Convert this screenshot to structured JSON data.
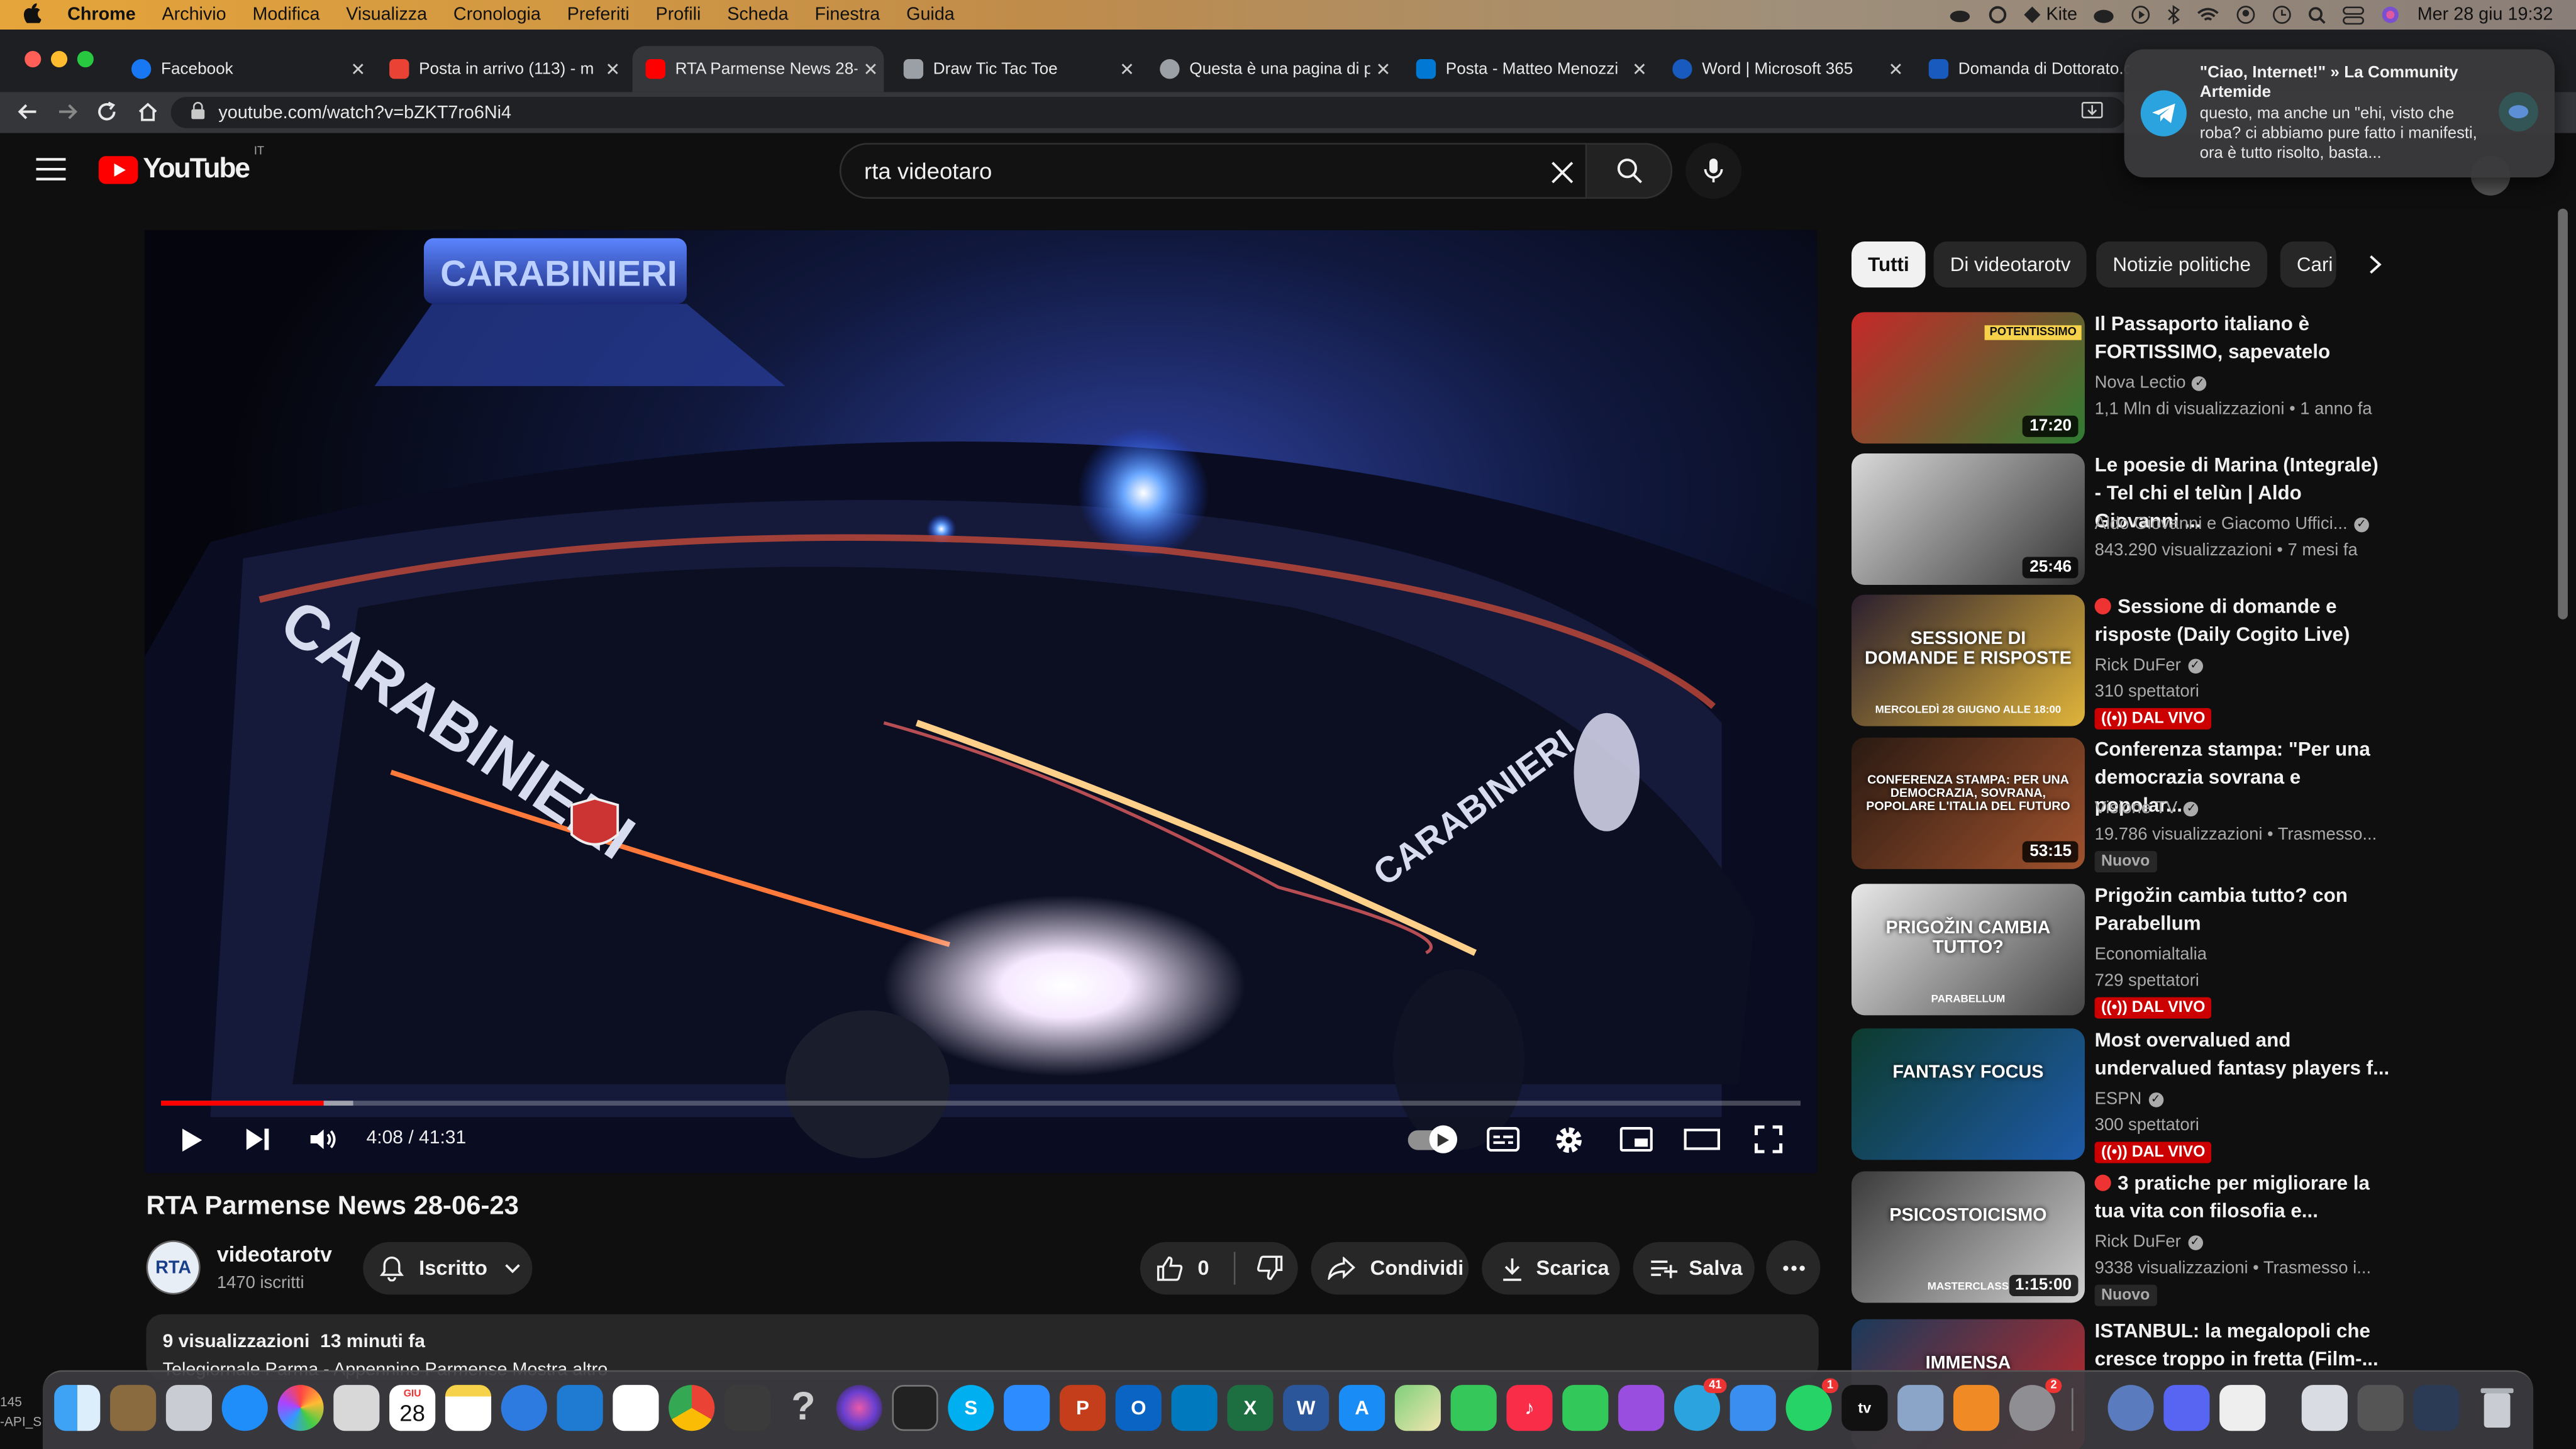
{
  "menubar": {
    "app": "Chrome",
    "items": [
      "Archivio",
      "Modifica",
      "Visualizza",
      "Cronologia",
      "Preferiti",
      "Profili",
      "Scheda",
      "Finestra",
      "Guida"
    ],
    "kite_label": "Kite",
    "clock": "Mer 28 giu  19:32"
  },
  "tabs": [
    {
      "title": "Facebook",
      "favicon_color": "#1877f2"
    },
    {
      "title": "Posta in arrivo (113) - m",
      "favicon_color": "#ea4335"
    },
    {
      "title": "RTA Parmense News 28-",
      "favicon_color": "#ff0000"
    },
    {
      "title": "Draw Tic Tac Toe",
      "favicon_color": "#9aa0a6"
    },
    {
      "title": "Questa è una pagina di p",
      "favicon_color": "#9aa0a6"
    },
    {
      "title": "Posta - Matteo Menozzi",
      "favicon_color": "#0078d4"
    },
    {
      "title": "Word | Microsoft 365",
      "favicon_color": "#185abd"
    },
    {
      "title": "Domanda di Dottorato.c",
      "favicon_color": "#185abd"
    }
  ],
  "address": {
    "url": "youtube.com/watch?v=bZKT7ro6Ni4"
  },
  "notification": {
    "title": "\"Ciao, Internet!\" » La Community Artemide",
    "body": "questo, ma anche un \"ehi, visto che roba? ci abbiamo pure fatto i manifesti, ora è tutto risolto, basta..."
  },
  "youtube": {
    "logo_text": "YouTube",
    "country": "IT",
    "search_value": "rta videotaro"
  },
  "video": {
    "time": "4:08 / 41:31",
    "played_fraction": 0.0996,
    "buffered_fraction": 0.117,
    "overlay_texts": [
      "CARABINIERI",
      "CARABINIERI",
      "CARABINIERI"
    ]
  },
  "info": {
    "title": "RTA Parmense News 28-06-23",
    "channel": "videotarotv",
    "avatar_text": "RTA",
    "subscribers": "1470 iscritti",
    "subscribed_label": "Iscritto",
    "likes": "0",
    "share": "Condividi",
    "download": "Scarica",
    "save": "Salva",
    "views_time": "9 visualizzazioni  13 minuti fa",
    "desc_line": "Telegiornale Parma - Appennino Parmense Mostra altro"
  },
  "chips": [
    "Tutti",
    "Di videotarotv",
    "Notizie politiche",
    "Cari"
  ],
  "recommendations": [
    {
      "title": "Il Passaporto italiano è FORTISSIMO, sapevatelo",
      "channel": "Nova Lectio",
      "verified": true,
      "meta": "1,1 Mln di visualizzazioni  • 1 anno fa",
      "duration": "17:20",
      "thumb_text": "POTENTISSIMO",
      "thumb_colors": [
        "#c62828",
        "#2e7d32"
      ]
    },
    {
      "title": "Le poesie di Marina (Integrale) - Tel chi el telùn | Aldo Giovanni ...",
      "channel": "Aldo Giovanni e Giacomo Uffici...",
      "verified": true,
      "meta": "843.290 visualizzazioni  • 7 mesi fa",
      "duration": "25:46",
      "thumb_text": "",
      "thumb_colors": [
        "#d9d9d9",
        "#333333"
      ]
    },
    {
      "title": "Sessione di domande e risposte (Daily Cogito Live)",
      "channel": "Rick DuFer",
      "verified": true,
      "meta": "310 spettatori",
      "live_badge": "DAL VIVO",
      "thumb_text": "SESSIONE DI DOMANDE E RISPOSTE",
      "thumb_sub": "MERCOLEDÌ 28 GIUGNO ALLE 18:00",
      "thumb_colors": [
        "#2b1f2e",
        "#e0b43a"
      ]
    },
    {
      "title": "Conferenza stampa: \"Per una democrazia sovrana e popolar...",
      "channel": "Visione TV",
      "verified": true,
      "meta": "19.786 visualizzazioni  • Trasmesso...",
      "new_badge": "Nuovo",
      "duration": "53:15",
      "thumb_text": "CONFERENZA STAMPA: PER UNA DEMOCRAZIA, SOVRANA, POPOLARE L'ITALIA DEL FUTURO",
      "thumb_colors": [
        "#2a1a12",
        "#a0522d"
      ]
    },
    {
      "title": "Prigožin cambia tutto? con Parabellum",
      "channel": "Economialtalia",
      "verified": false,
      "meta": "729 spettatori",
      "live_badge": "DAL VIVO",
      "thumb_text": "PRIGOŽIN CAMBIA TUTTO?",
      "thumb_sub": "PARABELLUM",
      "thumb_colors": [
        "#e8e8e8",
        "#444444"
      ]
    },
    {
      "title": "Most overvalued and undervalued fantasy players f...",
      "channel": "ESPN",
      "verified": true,
      "meta": "300 spettatori",
      "live_badge": "DAL VIVO",
      "thumb_text": "FANTASY FOCUS",
      "thumb_colors": [
        "#0d3b2e",
        "#1e5aa8"
      ]
    },
    {
      "title": "3 pratiche per migliorare la tua vita con filosofia e...",
      "channel": "Rick DuFer",
      "verified": true,
      "meta": "9338 visualizzazioni  • Trasmesso i...",
      "new_badge": "Nuovo",
      "duration": "1:15:00",
      "thumb_text": "PSICOSTOICISMO",
      "thumb_sub": "MASTERCLASS",
      "thumb_colors": [
        "#3a3a3a",
        "#d0d0d0"
      ]
    },
    {
      "title": "ISTANBUL: la megalopoli che cresce troppo in fretta (Film-...",
      "channel": "",
      "verified": false,
      "meta": "",
      "thumb_text": "IMMENSA",
      "thumb_colors": [
        "#1a3a5a",
        "#c62828"
      ]
    }
  ],
  "dock": {
    "calendar_month": "GIU",
    "calendar_day": "28",
    "badges": {
      "telegram": "41",
      "whatsapp": "1",
      "settings": "2"
    }
  },
  "left_edge_text": {
    "line1": "145",
    "line2": "-API_S"
  }
}
